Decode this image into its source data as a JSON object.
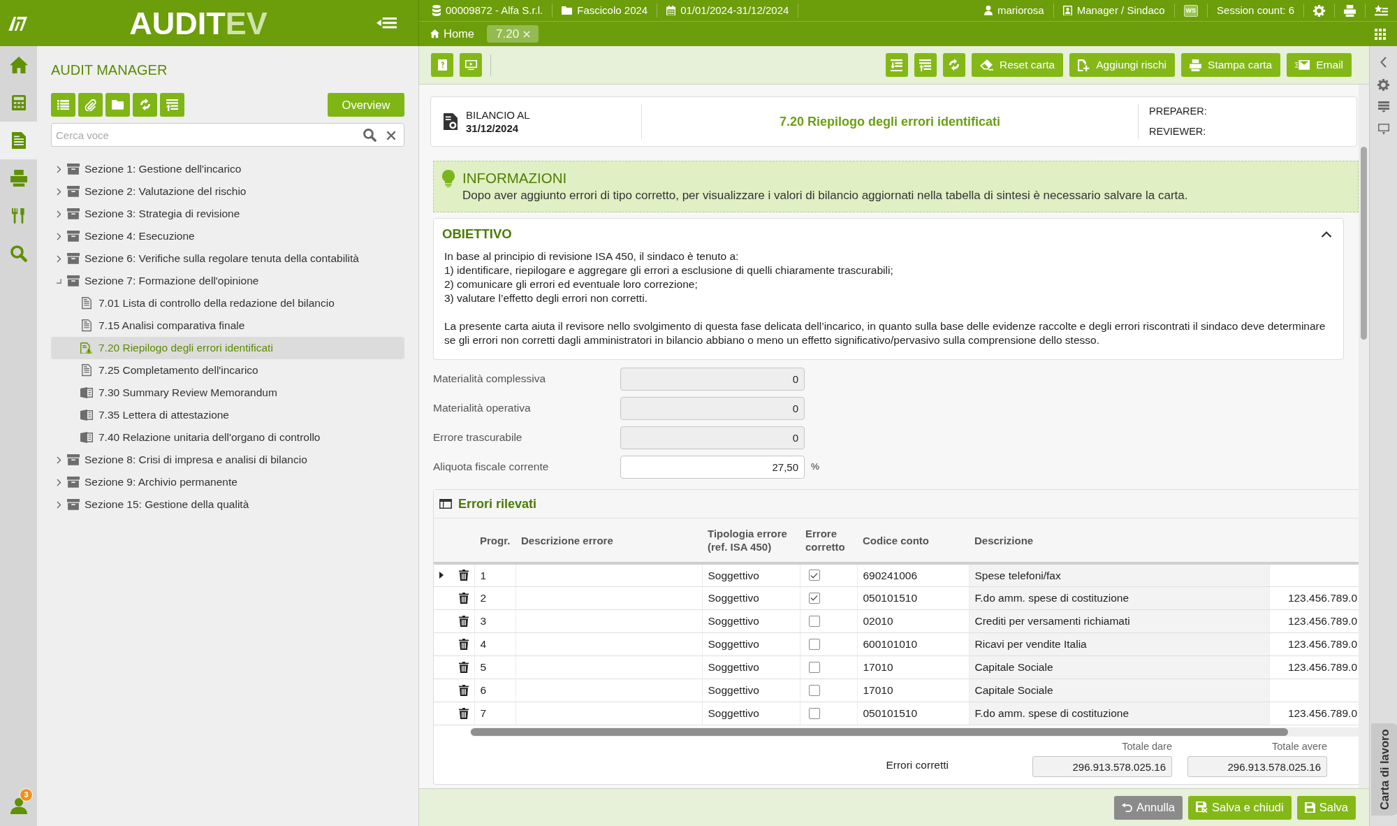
{
  "header": {
    "logo": {
      "main": "AUDIT",
      "accent": "EV"
    },
    "context": [
      {
        "kind": "client",
        "text": "00009872 - Alfa S.r.l."
      },
      {
        "kind": "folder",
        "text": "Fascicolo 2024"
      },
      {
        "kind": "period",
        "text": "01/01/2024-31/12/2024"
      }
    ],
    "user_menu": [
      {
        "kind": "user",
        "text": "mariorosa"
      },
      {
        "kind": "role",
        "text": "Manager / Sindaco"
      },
      {
        "kind": "badge",
        "text": "WS"
      },
      {
        "kind": "session",
        "text": "Session count: 6"
      },
      {
        "kind": "settings"
      },
      {
        "kind": "print"
      },
      {
        "kind": "favorites"
      }
    ],
    "tabs": [
      {
        "kind": "home",
        "label": "Home",
        "selected": false,
        "closable": false
      },
      {
        "kind": "document",
        "label": "7.20",
        "selected": true,
        "closable": true
      }
    ]
  },
  "rail": {
    "items": [
      {
        "kind": "home",
        "selected": false
      },
      {
        "kind": "calculator",
        "selected": false
      },
      {
        "kind": "document",
        "selected": true
      },
      {
        "kind": "printer",
        "selected": false
      },
      {
        "kind": "tools",
        "selected": false
      },
      {
        "kind": "search",
        "selected": false
      }
    ],
    "notifications": "3"
  },
  "sidebar": {
    "title": "AUDIT MANAGER",
    "tools": [
      {
        "kind": "list"
      },
      {
        "kind": "attach"
      },
      {
        "kind": "folder"
      },
      {
        "kind": "sync"
      },
      {
        "kind": "upload"
      }
    ],
    "overview": "Overview",
    "search": {
      "placeholder": "Cerca voce"
    },
    "tree": [
      {
        "kind": "section",
        "label": "Sezione 1: Gestione dell'incarico",
        "expanded": false,
        "selected": false
      },
      {
        "kind": "section",
        "label": "Sezione 2: Valutazione del rischio",
        "expanded": false,
        "selected": false
      },
      {
        "kind": "section",
        "label": "Sezione 3: Strategia di revisione",
        "expanded": false,
        "selected": false
      },
      {
        "kind": "section",
        "label": "Sezione 4: Esecuzione",
        "expanded": false,
        "selected": false
      },
      {
        "kind": "section",
        "label": "Sezione 6: Verifiche sulla regolare tenuta della contabilità",
        "expanded": false,
        "selected": false
      },
      {
        "kind": "section",
        "label": "Sezione 7: Formazione dell'opinione",
        "expanded": true,
        "selected": false,
        "children": [
          {
            "kind": "page",
            "label": "7.01 Lista di controllo della redazione del bilancio",
            "selected": false
          },
          {
            "kind": "page",
            "label": "7.15 Analisi comparativa finale",
            "selected": false
          },
          {
            "kind": "warning",
            "label": "7.20 Riepilogo degli errori identificati",
            "selected": true
          },
          {
            "kind": "page",
            "label": "7.25 Completamento dell'incarico",
            "selected": false
          },
          {
            "kind": "file",
            "label": "7.30 Summary Review Memorandum",
            "selected": false
          },
          {
            "kind": "file",
            "label": "7.35 Lettera di attestazione",
            "selected": false
          },
          {
            "kind": "file",
            "label": "7.40 Relazione unitaria dell'organo di controllo",
            "selected": false
          }
        ]
      },
      {
        "kind": "section",
        "label": "Sezione 8: Crisi di impresa e analisi di bilancio",
        "expanded": false,
        "selected": false
      },
      {
        "kind": "section",
        "label": "Sezione 9: Archivio permanente",
        "expanded": false,
        "selected": false
      },
      {
        "kind": "section",
        "label": "Sezione 15: Gestione della qualità",
        "expanded": false,
        "selected": false
      }
    ]
  },
  "toolbar": {
    "left": [
      {
        "kind": "help"
      },
      {
        "kind": "presentation"
      }
    ],
    "right": [
      {
        "kind": "indent"
      },
      {
        "kind": "upload"
      },
      {
        "kind": "sync"
      },
      {
        "kind": "eraser",
        "label": "Reset carta"
      },
      {
        "kind": "add",
        "label": "Aggiungi rischi"
      },
      {
        "kind": "print",
        "label": "Stampa carta"
      },
      {
        "kind": "email",
        "label": "Email"
      }
    ]
  },
  "card": {
    "balance_label": "BILANCIO AL",
    "balance_date": "31/12/2024",
    "title": "7.20 Riepilogo degli errori identificati",
    "preparer": "PREPARER:",
    "reviewer": "REVIEWER:"
  },
  "info": {
    "title": "INFORMAZIONI",
    "text": "Dopo aver aggiunto errori di tipo corretto, per visualizzare i valori di bilancio aggiornati nella tabella di sintesi è necessario salvare la carta."
  },
  "objective": {
    "title": "OBIETTIVO",
    "expanded": true,
    "intro": "In base al principio di revisione ISA 450, il sindaco è tenuto a:",
    "points": [
      "1) identificare, riepilogare e aggregare gli errori a esclusione di quelli chiaramente trascurabili;",
      "2) comunicare gli errori ed eventuale loro correzione;",
      "3) valutare l’effetto degli errori non corretti."
    ],
    "closing": "La presente carta aiuta il revisore nello svolgimento di questa fase delicata dell’incarico, in quanto sulla base delle evidenze raccolte e degli errori riscontrati il sindaco deve determinare se gli errori non corretti dagli amministratori in bilancio abbiano o meno un effetto significativo/pervasivo sulla comprensione dello stesso."
  },
  "fields": [
    {
      "label": "Materialità complessiva",
      "value": "0",
      "readonly": true
    },
    {
      "label": "Materialità operativa",
      "value": "0",
      "readonly": true
    },
    {
      "label": "Errore trascurabile",
      "value": "0",
      "readonly": true
    },
    {
      "label": "Aliquota fiscale corrente",
      "value": "27,50",
      "readonly": false,
      "unit": "%"
    }
  ],
  "errors": {
    "title": "Errori rilevati",
    "columns": [
      "Progr.",
      "Descrizione errore",
      "Tipologia errore (ref. ISA 450)",
      "Errore corretto",
      "Codice conto",
      "Descrizione"
    ],
    "rows": [
      {
        "expandable": true,
        "progr": "1",
        "type": "Soggettivo",
        "corrected": true,
        "account": "690241006",
        "account_name": "Spese telefoni/fax"
      },
      {
        "expandable": false,
        "progr": "2",
        "type": "Soggettivo",
        "corrected": true,
        "account": "050101510",
        "account_name": "F.do amm. spese di costituzione",
        "column_9": "123.456.789.0"
      },
      {
        "expandable": false,
        "progr": "3",
        "type": "Soggettivo",
        "corrected": false,
        "account": "02010",
        "account_name": "Crediti per versamenti richiamati",
        "column_9": "123.456.789.0"
      },
      {
        "expandable": false,
        "progr": "4",
        "type": "Soggettivo",
        "corrected": false,
        "account": "600101010",
        "account_name": "Ricavi per vendite Italia",
        "column_9": "123.456.789.0"
      },
      {
        "expandable": false,
        "progr": "5",
        "type": "Soggettivo",
        "corrected": false,
        "account": "17010",
        "account_name": "Capitale Sociale",
        "column_9": "123.456.789.0"
      },
      {
        "expandable": false,
        "progr": "6",
        "type": "Soggettivo",
        "corrected": false,
        "account": "17010",
        "account_name": "Capitale Sociale"
      },
      {
        "expandable": false,
        "progr": "7",
        "type": "Soggettivo",
        "corrected": false,
        "account": "050101510",
        "account_name": "F.do amm. spese di costituzione",
        "column_9": "123.456.789.0"
      }
    ],
    "totals": {
      "label": "Errori corretti",
      "debit_label": "Totale dare",
      "debit": "296.913.578.025.16",
      "credit_label": "Totale avere",
      "credit": "296.913.578.025.16"
    }
  },
  "footer": {
    "buttons": [
      {
        "kind": "cancel",
        "label": "Annulla"
      },
      {
        "kind": "save-close",
        "label": "Salva e chiudi"
      },
      {
        "kind": "save",
        "label": "Salva"
      }
    ]
  },
  "right_rail": {
    "items": [
      {
        "kind": "collapse"
      },
      {
        "kind": "settings"
      },
      {
        "kind": "list"
      },
      {
        "kind": "monitor"
      }
    ],
    "tab": "Carta di lavoro"
  }
}
